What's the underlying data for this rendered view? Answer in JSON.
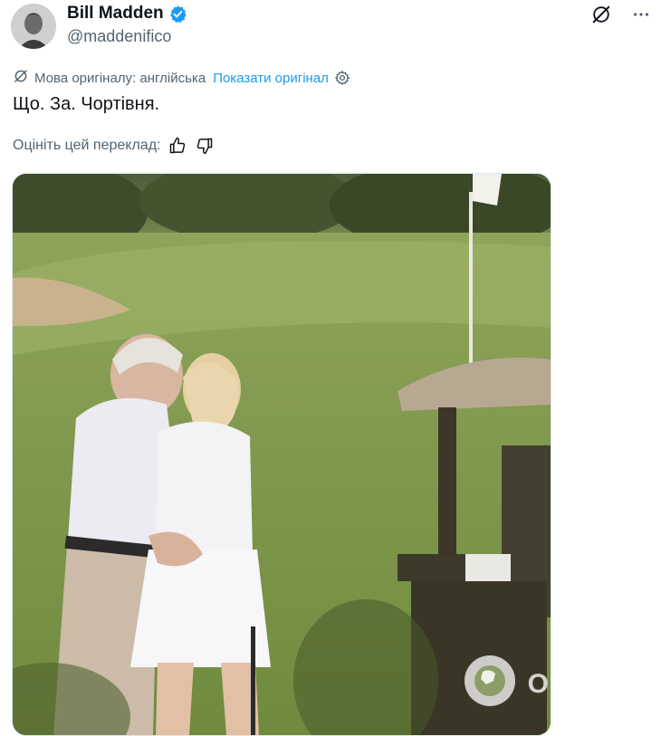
{
  "author": {
    "display_name": "Bill Madden",
    "handle": "@maddenifico",
    "verified_badge_icon": "verified-icon",
    "badge_color": "#1d9bf0"
  },
  "actions": {
    "grok_icon": "grok-icon",
    "more_icon": "more-icon"
  },
  "translation": {
    "icon": "grok-translate-icon",
    "source_language_label": "Мова оригіналу: англійська",
    "show_original_label": "Показати оригінал",
    "settings_icon": "gear-icon"
  },
  "tweet": {
    "text": "Що. За. Чортівня."
  },
  "rating": {
    "label": "Оцініть цей переклад:",
    "thumbs_up_icon": "thumbs-up-icon",
    "thumbs_down_icon": "thumbs-down-icon"
  },
  "media": {
    "watermark_text": "OBOZ.UA",
    "watermark_icon": "globe-icon"
  },
  "colors": {
    "link": "#1d9bf0",
    "secondary_text": "#536471",
    "primary_text": "#0f1419"
  }
}
